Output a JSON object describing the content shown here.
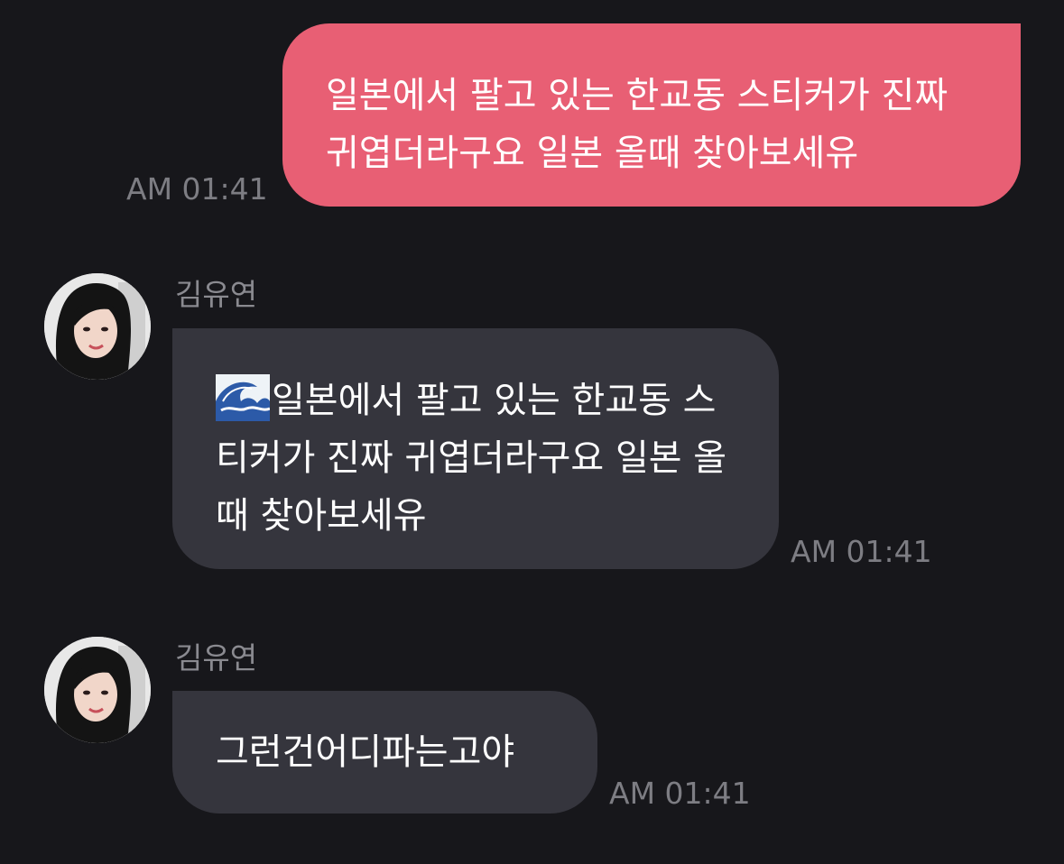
{
  "messages": [
    {
      "direction": "outgoing",
      "text": "일본에서 팔고 있는 한교동 스티커가 진짜 귀엽더라구요 일본 올때 찾아보세유",
      "time": "AM 01:41"
    },
    {
      "direction": "incoming",
      "sender": "김유연",
      "emoji": "water-wave-emoji",
      "text": "일본에서 팔고 있는 한교동 스티커가 진짜 귀엽더라구요 일본 올때 찾아보세유",
      "time": "AM 01:41"
    },
    {
      "direction": "incoming",
      "sender": "김유연",
      "text": "그런건어디파는고야",
      "time": "AM 01:41"
    }
  ],
  "colors": {
    "background": "#17171b",
    "outgoing_bubble": "#e85f74",
    "incoming_bubble": "#35353d",
    "timestamp": "#7d7d83",
    "sender_name": "#8a8a90"
  }
}
